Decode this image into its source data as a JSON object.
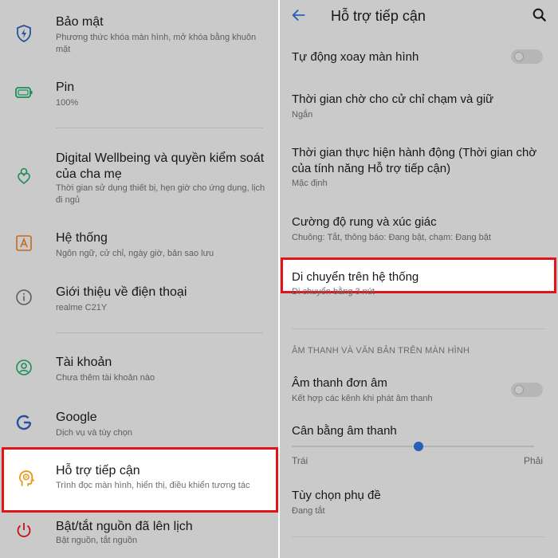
{
  "left": {
    "items": [
      {
        "title": "Bảo mật",
        "subtitle": "Phương thức khóa màn hình, mở khóa bằng khuôn mặt",
        "icon": "shield-lightning-icon"
      },
      {
        "title": "Pin",
        "subtitle": "100%",
        "icon": "battery-icon"
      },
      {
        "title": "Digital Wellbeing và quyền kiểm soát của cha mẹ",
        "subtitle": "Thời gian sử dụng thiết bị, hẹn giờ cho ứng dụng, lịch đi ngủ",
        "icon": "wellbeing-icon"
      },
      {
        "title": "Hệ thống",
        "subtitle": "Ngôn ngữ, cử chỉ, ngày giờ, bản sao lưu",
        "icon": "system-font-icon"
      },
      {
        "title": "Giới thiệu về điện thoại",
        "subtitle": "realme C21Y",
        "icon": "info-icon"
      },
      {
        "title": "Tài khoản",
        "subtitle": "Chưa thêm tài khoản nào",
        "icon": "account-icon"
      },
      {
        "title": "Google",
        "subtitle": "Dịch vụ và tùy chọn",
        "icon": "google-icon"
      },
      {
        "title": "Hỗ trợ tiếp cận",
        "subtitle": "Trình đọc màn hình, hiển thị, điều khiển tương tác",
        "icon": "accessibility-head-icon"
      },
      {
        "title": "Bật/tắt nguồn đã lên lịch",
        "subtitle": "Bật nguồn, tắt nguồn",
        "icon": "power-icon"
      }
    ]
  },
  "right": {
    "title": "Hỗ trợ tiếp cận",
    "items": [
      {
        "title": "Tự động xoay màn hình",
        "subtitle": ""
      },
      {
        "title": "Thời gian chờ cho cử chỉ chạm và giữ",
        "subtitle": "Ngắn"
      },
      {
        "title": "Thời gian thực hiện hành động (Thời gian chờ của tính năng Hỗ trợ tiếp cận)",
        "subtitle": "Mặc định"
      },
      {
        "title": "Cường độ rung và xúc giác",
        "subtitle": "Chuông: Tắt, thông báo: Đang bật, chạm: Đang bật"
      },
      {
        "title": "Di chuyển trên hệ thống",
        "subtitle": "Di chuyển bằng 3 nút"
      },
      {
        "title": "Âm thanh đơn âm",
        "subtitle": "Kết hợp các kênh khi phát âm thanh"
      },
      {
        "title": "Cân bằng âm thanh",
        "subtitle": ""
      },
      {
        "title": "Tùy chọn phụ đề",
        "subtitle": "Đang tắt"
      }
    ],
    "section_header": "ÂM THANH VÀ VĂN BẢN TRÊN MÀN HÌNH",
    "slider": {
      "left_label": "Trái",
      "right_label": "Phải",
      "value": 0.5
    },
    "toggles": {
      "auto_rotate": false,
      "mono_audio": false
    }
  },
  "colors": {
    "highlight_border": "#e0141b",
    "accent": "#2d6fd6",
    "accessibility_icon": "#e59a1c"
  }
}
